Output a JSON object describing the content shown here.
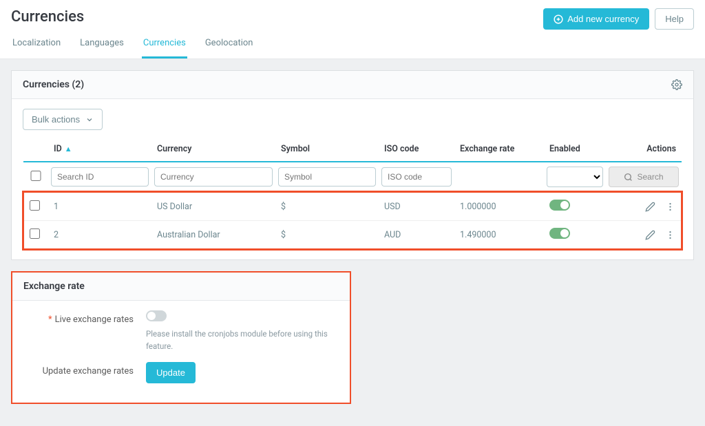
{
  "page": {
    "title": "Currencies"
  },
  "header": {
    "addBtn": "Add new currency",
    "helpBtn": "Help"
  },
  "tabs": [
    {
      "id": "localization",
      "label": "Localization"
    },
    {
      "id": "languages",
      "label": "Languages"
    },
    {
      "id": "currencies",
      "label": "Currencies"
    },
    {
      "id": "geolocation",
      "label": "Geolocation"
    }
  ],
  "activeTab": "currencies",
  "currenciesCard": {
    "title": "Currencies (2)",
    "bulkLabel": "Bulk actions",
    "columns": {
      "id": "ID",
      "currency": "Currency",
      "symbol": "Symbol",
      "iso": "ISO code",
      "rate": "Exchange rate",
      "enabled": "Enabled",
      "actions": "Actions"
    },
    "filters": {
      "idPh": "Search ID",
      "currencyPh": "Currency",
      "symbolPh": "Symbol",
      "isoPh": "ISO code",
      "searchBtn": "Search"
    },
    "rows": [
      {
        "id": "1",
        "currency": "US Dollar",
        "symbol": "$",
        "iso": "USD",
        "rate": "1.000000",
        "enabled": true
      },
      {
        "id": "2",
        "currency": "Australian Dollar",
        "symbol": "$",
        "iso": "AUD",
        "rate": "1.490000",
        "enabled": true
      }
    ]
  },
  "exchangeCard": {
    "title": "Exchange rate",
    "liveLabel": "Live exchange rates",
    "liveHelp": "Please install the cronjobs module before using this feature.",
    "updateLabel": "Update exchange rates",
    "updateBtn": "Update"
  }
}
